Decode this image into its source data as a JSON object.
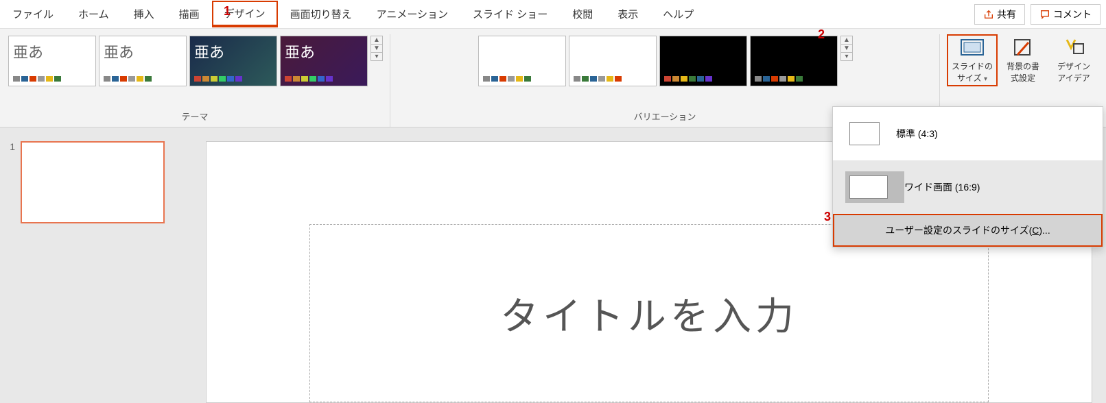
{
  "tabs": {
    "file": "ファイル",
    "home": "ホーム",
    "insert": "挿入",
    "draw": "描画",
    "design": "デザイン",
    "transitions": "画面切り替え",
    "animations": "アニメーション",
    "slideshow": "スライド ショー",
    "review": "校閲",
    "view": "表示",
    "help": "ヘルプ"
  },
  "topright": {
    "share": "共有",
    "comment": "コメント"
  },
  "markers": {
    "m1": "1",
    "m2": "2",
    "m3": "3"
  },
  "groups": {
    "themes": "テーマ",
    "variations": "バリエーション"
  },
  "theme_sample": "亜あ",
  "ribbon_buttons": {
    "slide_size_l1": "スライドの",
    "slide_size_l2": "サイズ",
    "bg_format_l1": "背景の書",
    "bg_format_l2": "式設定",
    "design_ideas_l1": "デザイン",
    "design_ideas_l2": "アイデア"
  },
  "dropdown": {
    "standard": "標準 (4:3)",
    "wide": "ワイド画面 (16:9)",
    "custom_pre": "ユーザー設定のスライドのサイズ(",
    "custom_key": "C",
    "custom_post": ")..."
  },
  "thumbs": {
    "slide1": "1"
  },
  "editor": {
    "title_placeholder": "タイトルを入力"
  }
}
